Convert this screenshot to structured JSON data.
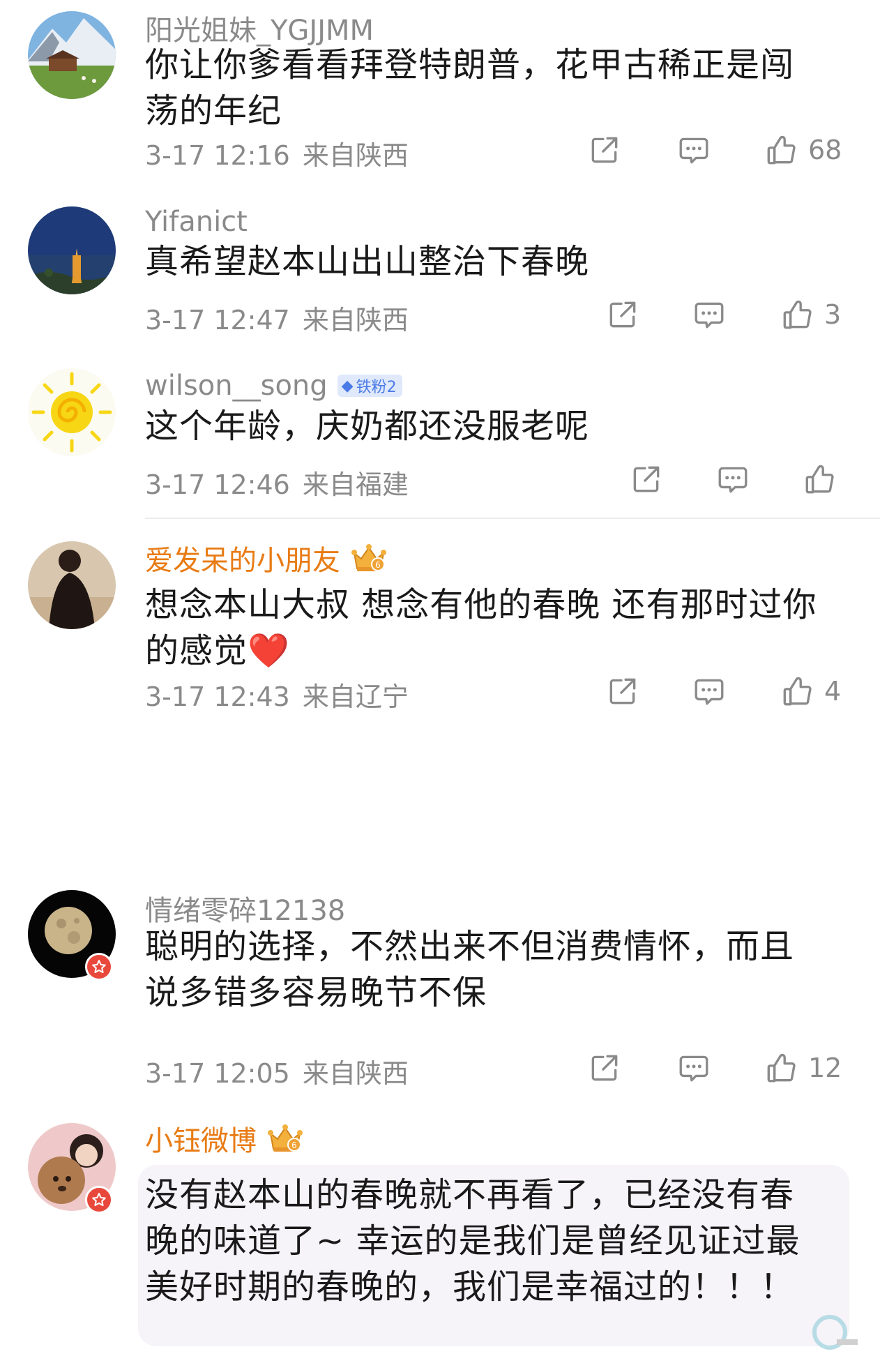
{
  "comments": [
    {
      "username": "阳光姐妹_YGJJMM",
      "text_lines": [
        "你让你爹看看拜登特朗普，花甲古稀正是闯",
        "荡的年纪"
      ],
      "time": "3-17 12:16",
      "location": "来自陕西",
      "likes": "68"
    },
    {
      "username": "Yifanict",
      "text_lines": [
        "真希望赵本山出山整治下春晚"
      ],
      "time": "3-17 12:47",
      "location": "来自陕西",
      "likes": "3"
    },
    {
      "username": "wilson__song",
      "badge": "铁粉2",
      "text_lines": [
        "这个年龄，庆奶都还没服老呢"
      ],
      "time": "3-17 12:46",
      "location": "来自福建",
      "likes": ""
    },
    {
      "username": "爱发呆的小朋友",
      "text_lines": [
        "想念本山大叔 想念有他的春晚 还有那时过你",
        "的感觉❤️"
      ],
      "time": "3-17 12:43",
      "location": "来自辽宁",
      "likes": "4"
    },
    {
      "username": "情绪零碎12138",
      "text_lines": [
        "聪明的选择，不然出来不但消费情怀，而且",
        "说多错多容易晚节不保"
      ],
      "time": "3-17 12:05",
      "location": "来自陕西",
      "likes": "12"
    },
    {
      "username": "小钰微博",
      "text_lines": [
        "没有赵本山的春晚就不再看了，已经没有春",
        "晚的味道了~ 幸运的是我们是曾经见证过最",
        "美好时期的春晚的，我们是幸福过的！！！"
      ]
    }
  ],
  "colors": {
    "vip_name": "#e87b14",
    "meta_gray": "#8a8a8a",
    "fan_badge_bg": "#dfe9fb",
    "fan_badge_text": "#4b7be6"
  },
  "icons": [
    "share-icon",
    "comment-icon",
    "like-icon",
    "crown-icon",
    "verified-icon",
    "heart-emoji"
  ]
}
